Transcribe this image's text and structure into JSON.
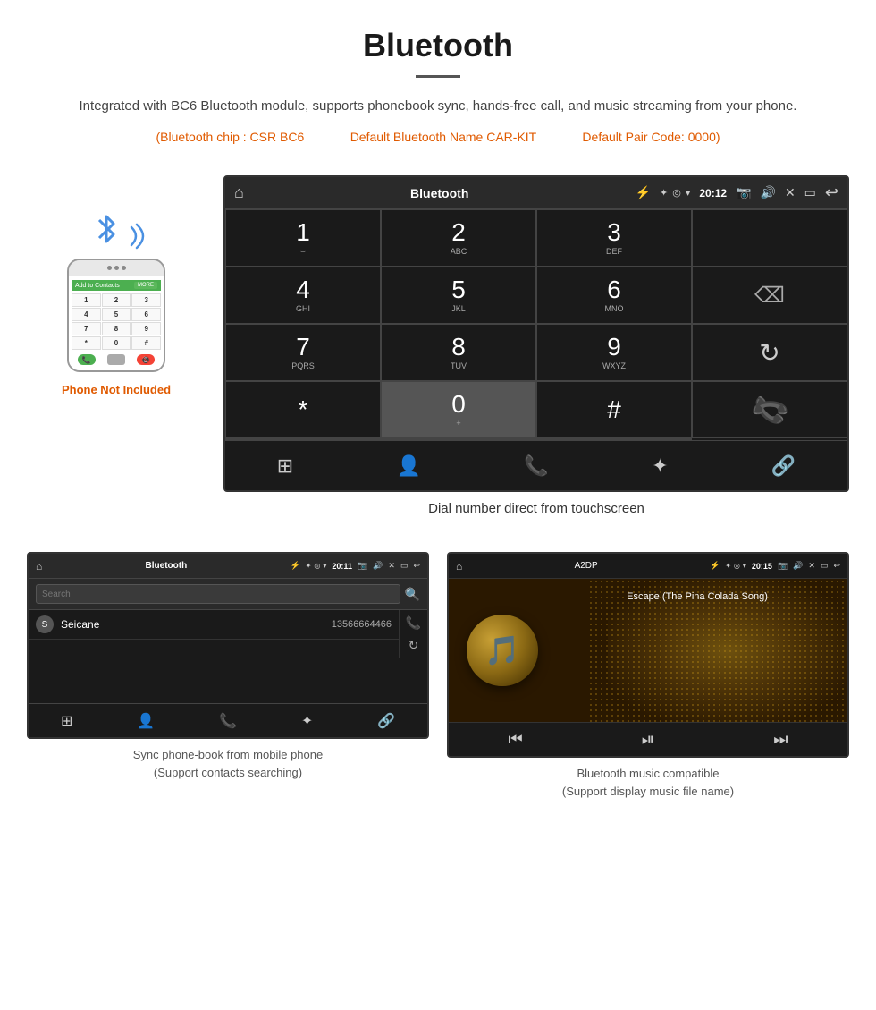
{
  "header": {
    "title": "Bluetooth",
    "description": "Integrated with BC6 Bluetooth module, supports phonebook sync, hands-free call, and music streaming from your phone.",
    "specs": {
      "chip": "(Bluetooth chip : CSR BC6",
      "name": "Default Bluetooth Name CAR-KIT",
      "pair": "Default Pair Code: 0000)"
    }
  },
  "phone": {
    "not_included_label": "Phone Not Included",
    "screen_title": "Add to Contacts",
    "keys": [
      "1",
      "2",
      "3",
      "4",
      "5",
      "6",
      "7",
      "8",
      "9",
      "*",
      "0",
      "#"
    ]
  },
  "dialer_screen": {
    "title": "Bluetooth",
    "time": "20:12",
    "keys": [
      {
        "num": "1",
        "sub": "⌣"
      },
      {
        "num": "2",
        "sub": "ABC"
      },
      {
        "num": "3",
        "sub": "DEF"
      },
      {
        "num": "4",
        "sub": "GHI"
      },
      {
        "num": "5",
        "sub": "JKL"
      },
      {
        "num": "6",
        "sub": "MNO"
      },
      {
        "num": "7",
        "sub": "PQRS"
      },
      {
        "num": "8",
        "sub": "TUV"
      },
      {
        "num": "9",
        "sub": "WXYZ"
      },
      {
        "num": "*",
        "sub": ""
      },
      {
        "num": "0",
        "sub": "+"
      },
      {
        "num": "#",
        "sub": ""
      }
    ]
  },
  "dialer_caption": "Dial number direct from touchscreen",
  "phonebook_screen": {
    "title": "Bluetooth",
    "time": "20:11",
    "search_placeholder": "Search",
    "contact": {
      "letter": "S",
      "name": "Seicane",
      "number": "13566664466"
    }
  },
  "phonebook_caption_line1": "Sync phone-book from mobile phone",
  "phonebook_caption_line2": "(Support contacts searching)",
  "music_screen": {
    "title": "A2DP",
    "time": "20:15",
    "song_title": "Escape (The Pina Colada Song)"
  },
  "music_caption_line1": "Bluetooth music compatible",
  "music_caption_line2": "(Support display music file name)"
}
